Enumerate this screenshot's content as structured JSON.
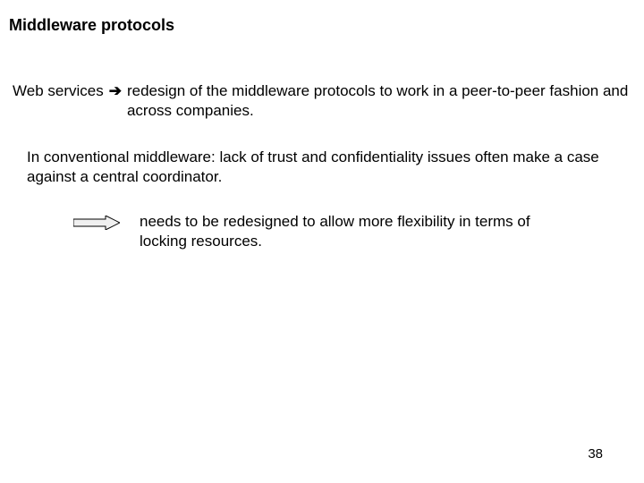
{
  "slide": {
    "title": "Middleware protocols",
    "line1_lead": "Web services",
    "line1_arrow": "➔",
    "line1_cont": "redesign of the middleware protocols to work in a peer-to-peer fashion and across companies.",
    "para2": "In conventional middleware: lack of trust and confidentiality issues often make a case against a central coordinator.",
    "para3": "needs to be redesigned to allow more flexibility in terms of locking resources.",
    "page_number": "38"
  }
}
